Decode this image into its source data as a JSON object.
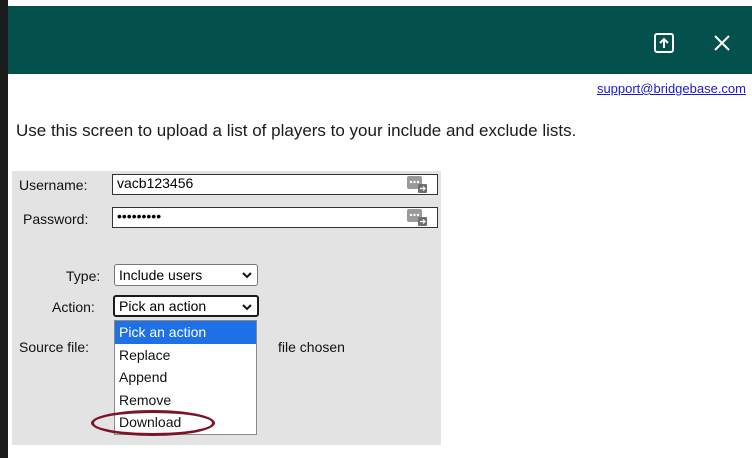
{
  "window": {
    "popout_icon": "popout-icon",
    "close_icon": "close-icon",
    "title_bar_color": "#04504c"
  },
  "support_email": "support@bridgebase.com",
  "intro_text": "Use this screen to upload a list of players to your include and exclude lists.",
  "form": {
    "username_label": "Username:",
    "username_value": "vacb123456",
    "password_label": "Password:",
    "password_value": "•••••••••",
    "type_label": "Type:",
    "type_value": "Include users",
    "action_label": "Action:",
    "action_value": "Pick an action",
    "source_file_label": "Source file:",
    "no_file_text": "file chosen"
  },
  "action_dropdown": {
    "options": [
      "Pick an action",
      "Replace",
      "Append",
      "Remove",
      "Download"
    ],
    "selected_index": 0,
    "highlighted_option": "Download",
    "highlight_color": "#7a1428",
    "selected_color": "#1e70e6"
  }
}
